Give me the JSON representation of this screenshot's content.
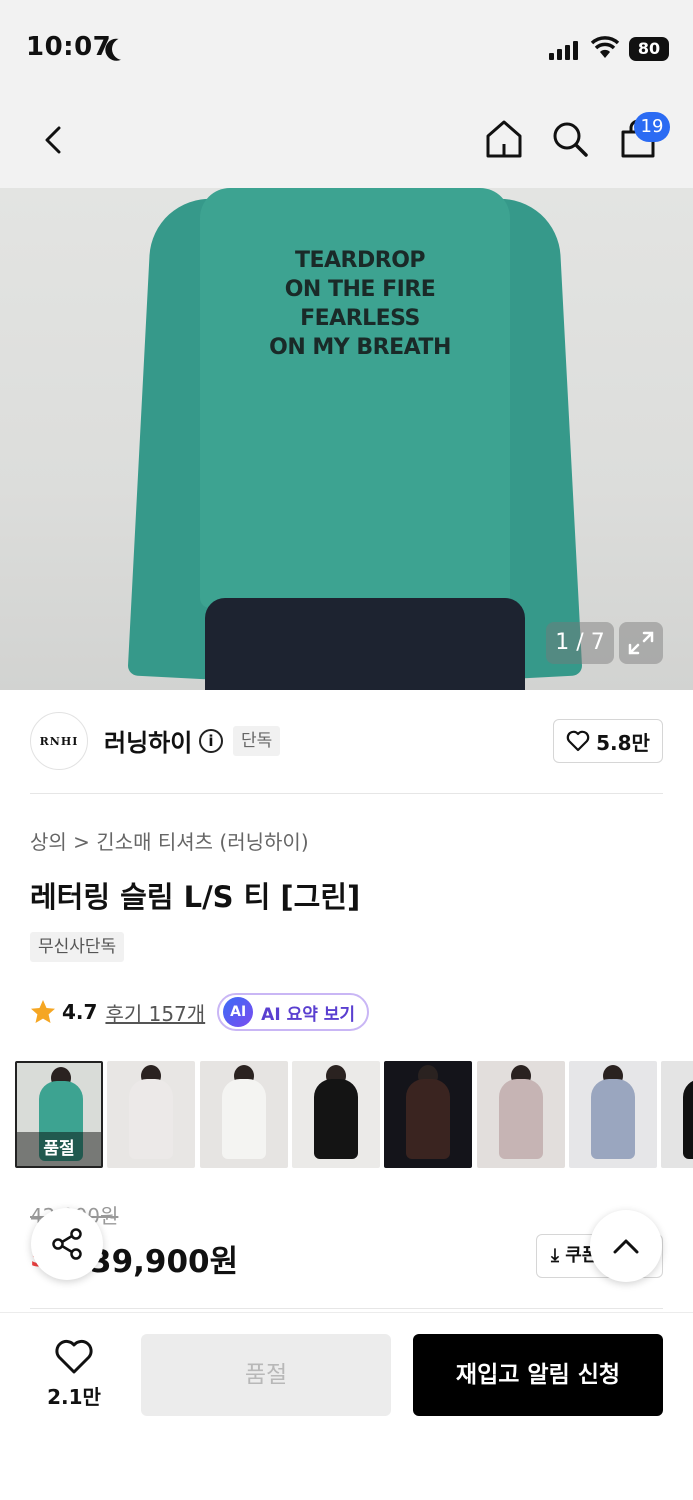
{
  "status_bar": {
    "time": "10:07",
    "battery": "80"
  },
  "nav": {
    "cart_count": "19"
  },
  "hero": {
    "shirt_print": [
      "TEARDROP",
      "ON THE FIRE",
      "FEARLESS",
      "ON MY BREATH"
    ],
    "counter": "1 / 7"
  },
  "brand": {
    "logo_text": "RNHI",
    "name": "러닝하이",
    "tag": "단독",
    "likes": "5.8만"
  },
  "product": {
    "breadcrumb_category": "상의",
    "breadcrumb_sub": "긴소매 티셔츠 (러닝하이)",
    "title": "레터링 슬림 L/S 티 [그린]",
    "exclusive_badge": "무신사단독",
    "rating": "4.7",
    "reviews": "후기 157개",
    "ai_icon": "AI",
    "ai_label": "AI 요약 보기"
  },
  "thumbnails": [
    {
      "label": "품절",
      "color": "#3da391",
      "bg": "#d9dcd8"
    },
    {
      "color": "#ece9e8",
      "bg": "#e8e6e4"
    },
    {
      "color": "#f4f4f2",
      "bg": "#e6e4e2"
    },
    {
      "color": "#141414",
      "bg": "#ebeae8"
    },
    {
      "color": "#3a2420",
      "bg": "#14141a"
    },
    {
      "color": "#c6b4b4",
      "bg": "#e2dedc"
    },
    {
      "color": "#9aa6bf",
      "bg": "#e6e6e8"
    },
    {
      "color": "#111111",
      "bg": "#e4e4e4"
    }
  ],
  "price": {
    "original": "42,000원",
    "discount": "5%",
    "current": "39,900원",
    "coupon": "쿠폰"
  },
  "bottom_bar": {
    "wish_count": "2.1만",
    "sold_out": "품절",
    "restock": "재입고 알림 신청"
  }
}
